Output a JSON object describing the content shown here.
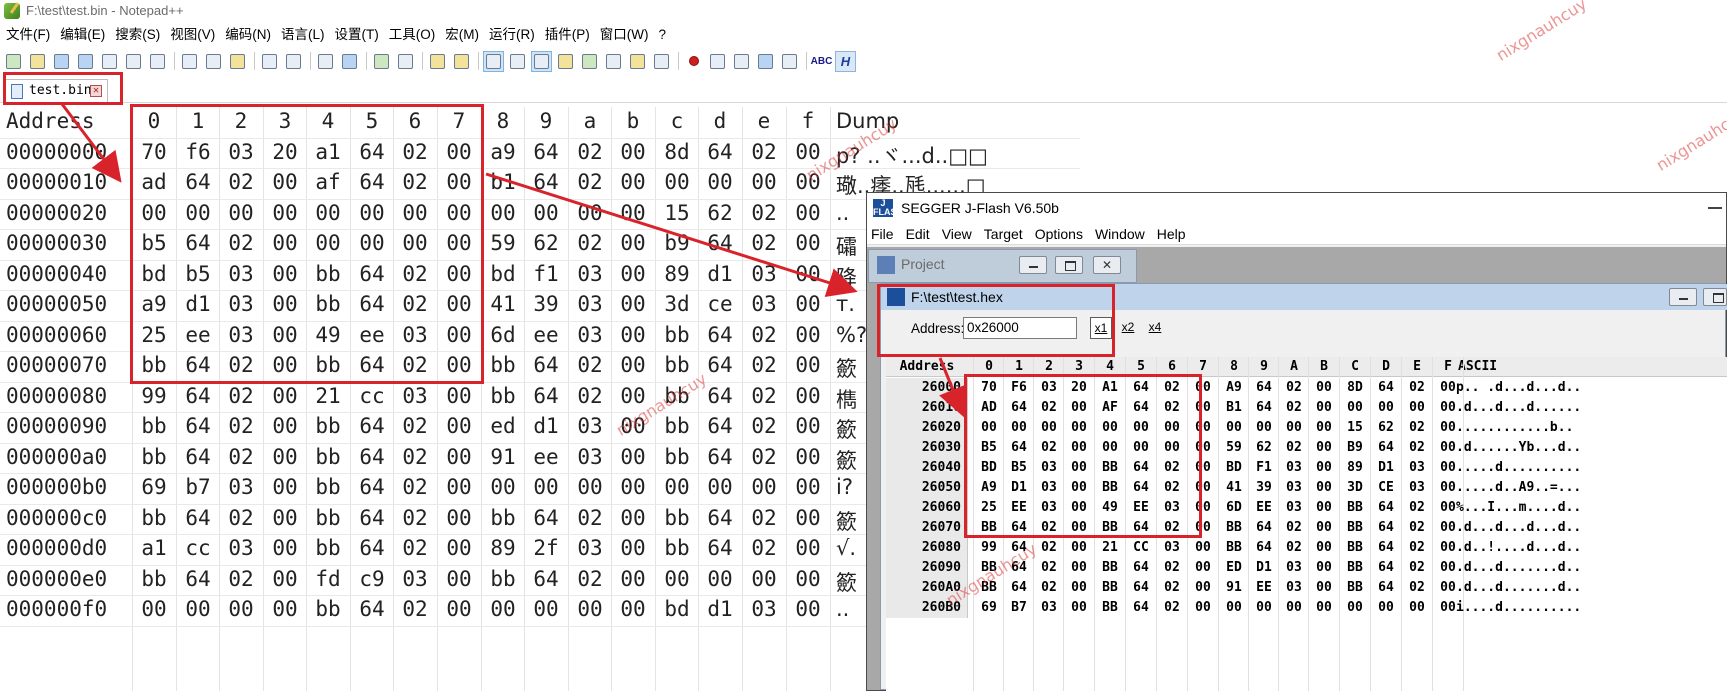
{
  "notepad": {
    "title": "F:\\test\\test.bin - Notepad++",
    "menu": [
      "文件(F)",
      "编辑(E)",
      "搜索(S)",
      "视图(V)",
      "编码(N)",
      "语言(L)",
      "设置(T)",
      "工具(O)",
      "宏(M)",
      "运行(R)",
      "插件(P)",
      "窗口(W)",
      "?"
    ],
    "tab": {
      "label": "test.bin"
    },
    "toolbar": {
      "spell_label": "ABC",
      "h_label": "H"
    },
    "hex": {
      "address_header": "Address",
      "columns": [
        "0",
        "1",
        "2",
        "3",
        "4",
        "5",
        "6",
        "7",
        "8",
        "9",
        "a",
        "b",
        "c",
        "d",
        "e",
        "f"
      ],
      "dump_header": "Dump",
      "rows": [
        {
          "addr": "00000000",
          "bytes": [
            "70",
            "f6",
            "03",
            "20",
            "a1",
            "64",
            "02",
            "00",
            "a9",
            "64",
            "02",
            "00",
            "8d",
            "64",
            "02",
            "00"
          ],
          "dump": "p?    ..ヾ...d..□□"
        },
        {
          "addr": "00000010",
          "bytes": [
            "ad",
            "64",
            "02",
            "00",
            "af",
            "64",
            "02",
            "00",
            "b1",
            "64",
            "02",
            "00",
            "00",
            "00",
            "00",
            "00"
          ],
          "dump": "璥..痵..瓱......□"
        },
        {
          "addr": "00000020",
          "bytes": [
            "00",
            "00",
            "00",
            "00",
            "00",
            "00",
            "00",
            "00",
            "00",
            "00",
            "00",
            "00",
            "15",
            "62",
            "02",
            "00"
          ],
          "dump": ".."
        },
        {
          "addr": "00000030",
          "bytes": [
            "b5",
            "64",
            "02",
            "00",
            "00",
            "00",
            "00",
            "00",
            "59",
            "62",
            "02",
            "00",
            "b9",
            "64",
            "02",
            "00"
          ],
          "dump": "礵"
        },
        {
          "addr": "00000040",
          "bytes": [
            "bd",
            "b5",
            "03",
            "00",
            "bb",
            "64",
            "02",
            "00",
            "bd",
            "f1",
            "03",
            "00",
            "89",
            "d1",
            "03",
            "00"
          ],
          "dump": "降"
        },
        {
          "addr": "00000050",
          "bytes": [
            "a9",
            "d1",
            "03",
            "00",
            "bb",
            "64",
            "02",
            "00",
            "41",
            "39",
            "03",
            "00",
            "3d",
            "ce",
            "03",
            "00"
          ],
          "dump": "т."
        },
        {
          "addr": "00000060",
          "bytes": [
            "25",
            "ee",
            "03",
            "00",
            "49",
            "ee",
            "03",
            "00",
            "6d",
            "ee",
            "03",
            "00",
            "bb",
            "64",
            "02",
            "00"
          ],
          "dump": "%?"
        },
        {
          "addr": "00000070",
          "bytes": [
            "bb",
            "64",
            "02",
            "00",
            "bb",
            "64",
            "02",
            "00",
            "bb",
            "64",
            "02",
            "00",
            "bb",
            "64",
            "02",
            "00"
          ],
          "dump": "籨"
        },
        {
          "addr": "00000080",
          "bytes": [
            "99",
            "64",
            "02",
            "00",
            "21",
            "cc",
            "03",
            "00",
            "bb",
            "64",
            "02",
            "00",
            "bb",
            "64",
            "02",
            "00"
          ],
          "dump": "檇"
        },
        {
          "addr": "00000090",
          "bytes": [
            "bb",
            "64",
            "02",
            "00",
            "bb",
            "64",
            "02",
            "00",
            "ed",
            "d1",
            "03",
            "00",
            "bb",
            "64",
            "02",
            "00"
          ],
          "dump": "籨"
        },
        {
          "addr": "000000a0",
          "bytes": [
            "bb",
            "64",
            "02",
            "00",
            "bb",
            "64",
            "02",
            "00",
            "91",
            "ee",
            "03",
            "00",
            "bb",
            "64",
            "02",
            "00"
          ],
          "dump": "籨"
        },
        {
          "addr": "000000b0",
          "bytes": [
            "69",
            "b7",
            "03",
            "00",
            "bb",
            "64",
            "02",
            "00",
            "00",
            "00",
            "00",
            "00",
            "00",
            "00",
            "00",
            "00"
          ],
          "dump": "i?"
        },
        {
          "addr": "000000c0",
          "bytes": [
            "bb",
            "64",
            "02",
            "00",
            "bb",
            "64",
            "02",
            "00",
            "bb",
            "64",
            "02",
            "00",
            "bb",
            "64",
            "02",
            "00"
          ],
          "dump": "籨"
        },
        {
          "addr": "000000d0",
          "bytes": [
            "a1",
            "cc",
            "03",
            "00",
            "bb",
            "64",
            "02",
            "00",
            "89",
            "2f",
            "03",
            "00",
            "bb",
            "64",
            "02",
            "00"
          ],
          "dump": "√."
        },
        {
          "addr": "000000e0",
          "bytes": [
            "bb",
            "64",
            "02",
            "00",
            "fd",
            "c9",
            "03",
            "00",
            "bb",
            "64",
            "02",
            "00",
            "00",
            "00",
            "00",
            "00"
          ],
          "dump": "籨"
        },
        {
          "addr": "000000f0",
          "bytes": [
            "00",
            "00",
            "00",
            "00",
            "bb",
            "64",
            "02",
            "00",
            "00",
            "00",
            "00",
            "00",
            "bd",
            "d1",
            "03",
            "00"
          ],
          "dump": ".."
        }
      ]
    }
  },
  "jflash": {
    "title": "SEGGER J-Flash V6.50b",
    "menu": [
      "File",
      "Edit",
      "View",
      "Target",
      "Options",
      "Window",
      "Help"
    ],
    "project_title": "Project",
    "hex_window_title": "F:\\test\\test.hex",
    "address_label": "Address:",
    "address_value": "0x26000",
    "zoom": [
      "x1",
      "x2",
      "x4"
    ],
    "header": {
      "address": "Address",
      "ascii": "ASCII",
      "columns": [
        "0",
        "1",
        "2",
        "3",
        "4",
        "5",
        "6",
        "7",
        "8",
        "9",
        "A",
        "B",
        "C",
        "D",
        "E",
        "F"
      ]
    },
    "rows": [
      {
        "addr": "26000",
        "bytes": [
          "70",
          "F6",
          "03",
          "20",
          "A1",
          "64",
          "02",
          "00",
          "A9",
          "64",
          "02",
          "00",
          "8D",
          "64",
          "02",
          "00"
        ],
        "ascii": "p.. .d...d...d.."
      },
      {
        "addr": "26010",
        "bytes": [
          "AD",
          "64",
          "02",
          "00",
          "AF",
          "64",
          "02",
          "00",
          "B1",
          "64",
          "02",
          "00",
          "00",
          "00",
          "00",
          "00"
        ],
        "ascii": ".d...d...d......"
      },
      {
        "addr": "26020",
        "bytes": [
          "00",
          "00",
          "00",
          "00",
          "00",
          "00",
          "00",
          "00",
          "00",
          "00",
          "00",
          "00",
          "15",
          "62",
          "02",
          "00"
        ],
        "ascii": "............b.."
      },
      {
        "addr": "26030",
        "bytes": [
          "B5",
          "64",
          "02",
          "00",
          "00",
          "00",
          "00",
          "00",
          "59",
          "62",
          "02",
          "00",
          "B9",
          "64",
          "02",
          "00"
        ],
        "ascii": ".d......Yb...d.."
      },
      {
        "addr": "26040",
        "bytes": [
          "BD",
          "B5",
          "03",
          "00",
          "BB",
          "64",
          "02",
          "00",
          "BD",
          "F1",
          "03",
          "00",
          "89",
          "D1",
          "03",
          "00"
        ],
        "ascii": ".....d.........."
      },
      {
        "addr": "26050",
        "bytes": [
          "A9",
          "D1",
          "03",
          "00",
          "BB",
          "64",
          "02",
          "00",
          "41",
          "39",
          "03",
          "00",
          "3D",
          "CE",
          "03",
          "00"
        ],
        "ascii": ".....d..A9..=..."
      },
      {
        "addr": "26060",
        "bytes": [
          "25",
          "EE",
          "03",
          "00",
          "49",
          "EE",
          "03",
          "00",
          "6D",
          "EE",
          "03",
          "00",
          "BB",
          "64",
          "02",
          "00"
        ],
        "ascii": "%...I...m....d.."
      },
      {
        "addr": "26070",
        "bytes": [
          "BB",
          "64",
          "02",
          "00",
          "BB",
          "64",
          "02",
          "00",
          "BB",
          "64",
          "02",
          "00",
          "BB",
          "64",
          "02",
          "00"
        ],
        "ascii": ".d...d...d...d.."
      },
      {
        "addr": "26080",
        "bytes": [
          "99",
          "64",
          "02",
          "00",
          "21",
          "CC",
          "03",
          "00",
          "BB",
          "64",
          "02",
          "00",
          "BB",
          "64",
          "02",
          "00"
        ],
        "ascii": ".d..!....d...d.."
      },
      {
        "addr": "26090",
        "bytes": [
          "BB",
          "64",
          "02",
          "00",
          "BB",
          "64",
          "02",
          "00",
          "ED",
          "D1",
          "03",
          "00",
          "BB",
          "64",
          "02",
          "00"
        ],
        "ascii": ".d...d.......d.."
      },
      {
        "addr": "260A0",
        "bytes": [
          "BB",
          "64",
          "02",
          "00",
          "BB",
          "64",
          "02",
          "00",
          "91",
          "EE",
          "03",
          "00",
          "BB",
          "64",
          "02",
          "00"
        ],
        "ascii": ".d...d.......d.."
      },
      {
        "addr": "260B0",
        "bytes": [
          "69",
          "B7",
          "03",
          "00",
          "BB",
          "64",
          "02",
          "00",
          "00",
          "00",
          "00",
          "00",
          "00",
          "00",
          "00",
          "00"
        ],
        "ascii": "i....d.........."
      }
    ]
  },
  "watermark": "nixgnauhcuy"
}
